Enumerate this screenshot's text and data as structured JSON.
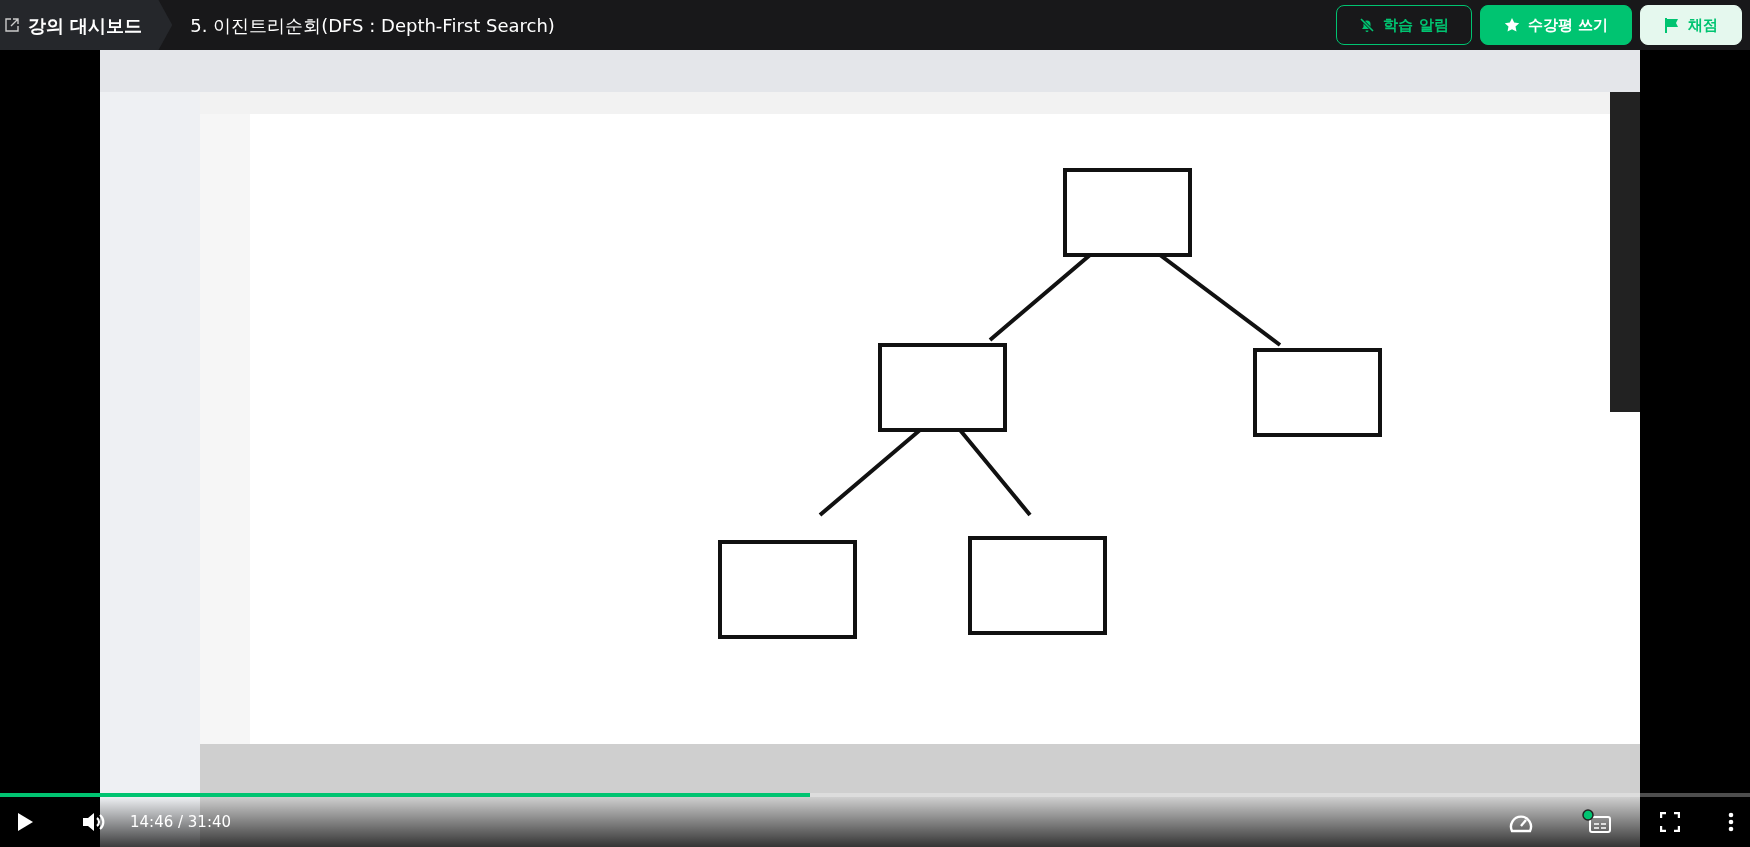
{
  "header": {
    "back_link": "강의 대시보드",
    "title": "5. 이진트리순회(DFS : Depth-First Search)",
    "buttons": [
      {
        "label": "학습 알림",
        "kind": "outline"
      },
      {
        "label": "수강평 쓰기",
        "kind": "primary"
      },
      {
        "label": "채점",
        "kind": "light"
      }
    ]
  },
  "player": {
    "progress": {
      "level": 0.463
    },
    "time": "14:46 / 31:40"
  }
}
